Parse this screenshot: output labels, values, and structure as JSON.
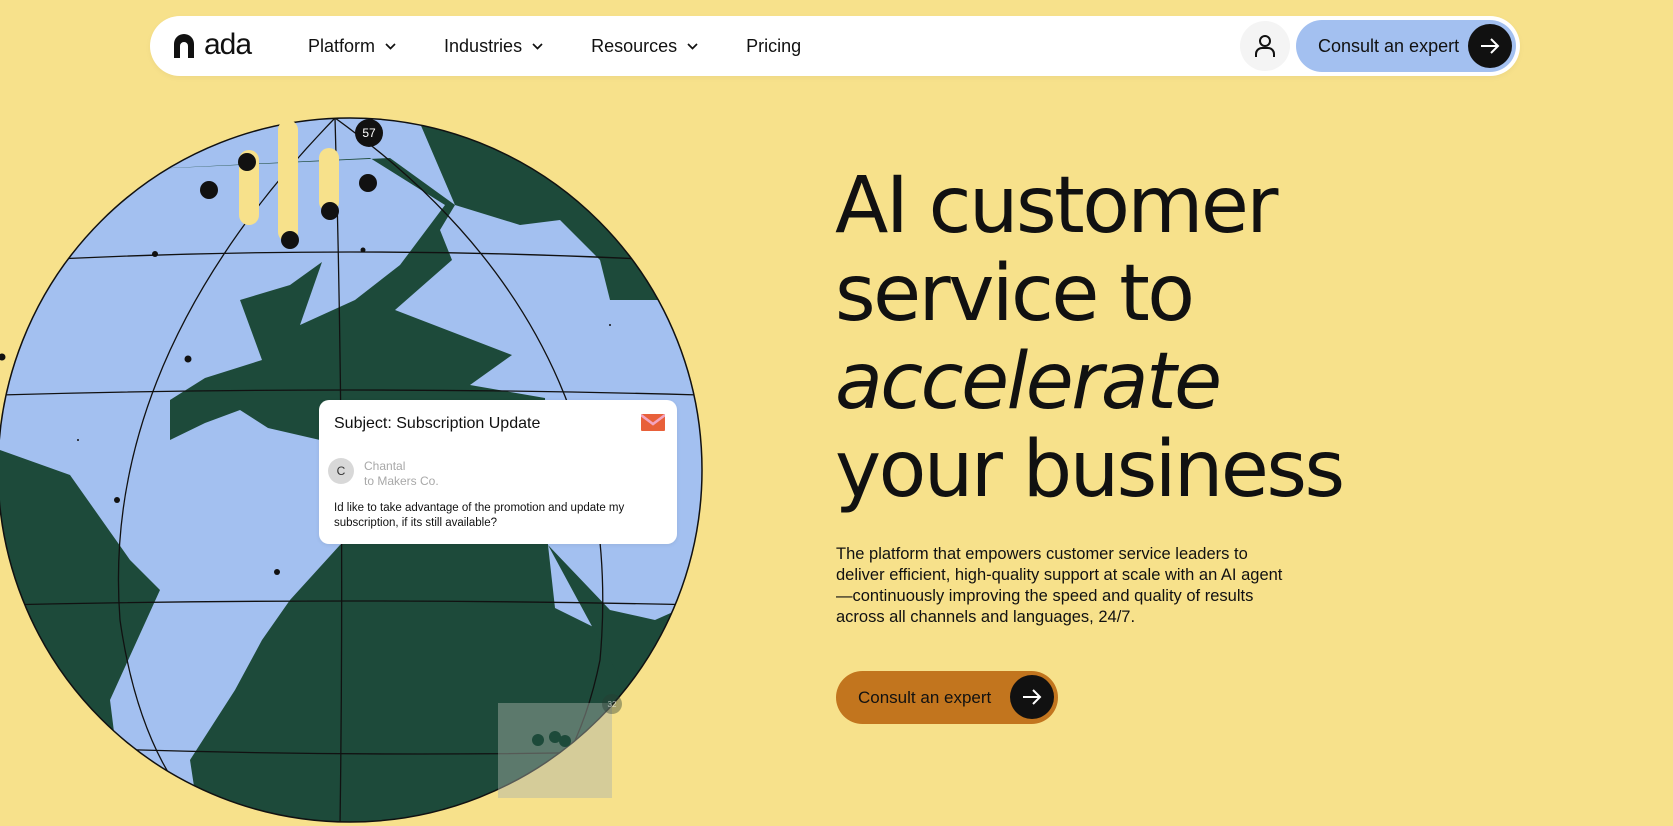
{
  "nav": {
    "logo_text": "ada",
    "items": [
      {
        "label": "Platform",
        "has_dropdown": true
      },
      {
        "label": "Industries",
        "has_dropdown": true
      },
      {
        "label": "Resources",
        "has_dropdown": true
      },
      {
        "label": "Pricing",
        "has_dropdown": false
      }
    ],
    "user_icon": "user-icon",
    "cta_label": "Consult an expert",
    "cta_icon": "arrow-right-icon"
  },
  "hero": {
    "headline_lines": [
      "AI customer",
      "service to",
      "accelerate",
      "your business"
    ],
    "subtext": "The platform that empowers customer service leaders to deliver efficient, high-quality support at scale with an AI agent—continuously improving the speed and quality of results across all channels and languages, 24/7.",
    "cta_label": "Consult an expert"
  },
  "illustration": {
    "pin_count": "57",
    "ghost_tag": "32",
    "email": {
      "subject": "Subject: Subscription Update",
      "avatar_initial": "C",
      "sender_name": "Chantal",
      "sender_to": "to Makers Co.",
      "body": "Id like to take advantage of the promotion and update my subscription, if its still available?"
    }
  },
  "colors": {
    "background": "#f7e18b",
    "globe_land": "#1d4a3a",
    "globe_water": "#a3c0f0",
    "cta_primary": "#c2751e",
    "cta_secondary": "#a3c0f0"
  }
}
